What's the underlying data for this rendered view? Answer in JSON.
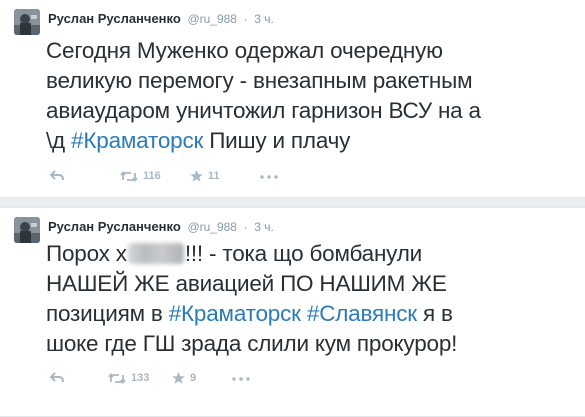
{
  "tweets": [
    {
      "name": "Руслан Русланченко",
      "handle": "@ru_988",
      "dot": "·",
      "time": "3 ч.",
      "lines": {
        "l1": "Сегодня Муженко одержал очередную",
        "l2": "великую перемогу - внезапным ракетным",
        "l3": "авиаударом уничтожил гарнизон ВСУ на а",
        "l4_pre": "\\д ",
        "l4_tag": "#Краматорск",
        "l4_post": " Пишу и плачу"
      },
      "retweets": "116",
      "favorites": "11"
    },
    {
      "name": "Руслан Русланченко",
      "handle": "@ru_988",
      "dot": "·",
      "time": "3 ч.",
      "lines": {
        "l1_pre": "Порох х",
        "l1_post": "!!! - тока що бомбанули",
        "l2": "НАШЕЙ ЖЕ авиацией ПО НАШИМ ЖЕ",
        "l3_pre": "позициям в ",
        "l3_tag1": "#Краматорск",
        "l3_mid": " ",
        "l3_tag2": "#Славянск",
        "l3_post": " я в",
        "l4": "шоке где ГШ зрада слили кум прокурор!"
      },
      "retweets": "133",
      "favorites": "9"
    }
  ],
  "colors": {
    "hashtag": "#2b7bb9",
    "meta": "#8899a6",
    "action_icon": "#aab8c2",
    "text": "#292f33",
    "background": "#e9edf0"
  },
  "icons": [
    "reply-icon",
    "retweet-icon",
    "favorite-star-icon",
    "more-icon"
  ]
}
